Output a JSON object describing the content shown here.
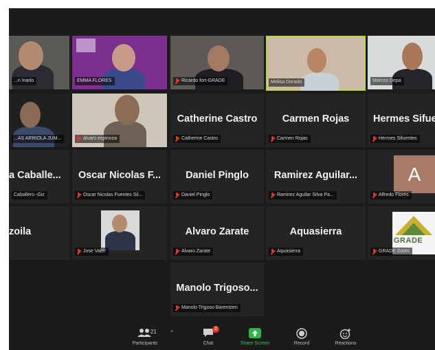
{
  "tiles": {
    "r1c1": {
      "label": "...n Inarlo"
    },
    "r1c2": {
      "label": "EMMA FLORES"
    },
    "r1c3": {
      "label": "Ricardo fort-GRADE"
    },
    "r1c4": {
      "label": "Melisa Dorado"
    },
    "r1c5": {
      "label": "Marcos Depa"
    },
    "r2c1": {
      "label": "...AS ARRIOLA JUM..."
    },
    "r2c2": {
      "label": "alvaro espinoza"
    },
    "r2c3": {
      "name": "Catherine Castro",
      "label": "Catherine Castro"
    },
    "r2c4": {
      "name": "Carmen Rojas",
      "label": "Carmen Rojas"
    },
    "r2c5": {
      "name": "Hermes Sifue",
      "label": "Hermes Sifuentes"
    },
    "r3c1": {
      "name": "a Caballe...",
      "label": "Caballero -Giz"
    },
    "r3c2": {
      "name": "Oscar Nicolas F...",
      "label": "Oscar Nicolas Fuentes Sil..."
    },
    "r3c3": {
      "name": "Daniel Pinglo",
      "label": "Daniel Pinglo"
    },
    "r3c4": {
      "name": "Ramirez Aguilar...",
      "label": "Ramirez Aguilar Silva Pa..."
    },
    "r3c5": {
      "avatar_letter": "A",
      "label": "Alfredo Flores"
    },
    "r4c1": {
      "name": "zoila"
    },
    "r4c2": {
      "label": "Jose Valer"
    },
    "r4c3": {
      "name": "Alvaro Zarate",
      "label": "Alvaro Zarate"
    },
    "r4c4": {
      "name": "Aquasierra",
      "label": "Aquasierra"
    },
    "r4c5": {
      "logo_text": "GRADE",
      "label": "GRADE Zoom"
    },
    "r5c3": {
      "name": "Manolo Trigoso...",
      "label": "Manolo Trigoso Barentzen"
    }
  },
  "toolbar": {
    "participants": {
      "label": "Participants",
      "count": "21"
    },
    "chat": {
      "label": "Chat",
      "badge": "2"
    },
    "share": {
      "label": "Share Screen"
    },
    "record": {
      "label": "Record"
    },
    "reactions": {
      "label": "Reactions"
    }
  },
  "colors": {
    "active_speaker": "#b9d63a",
    "muted_mic": "#e0382b",
    "share_green": "#2fb543"
  }
}
